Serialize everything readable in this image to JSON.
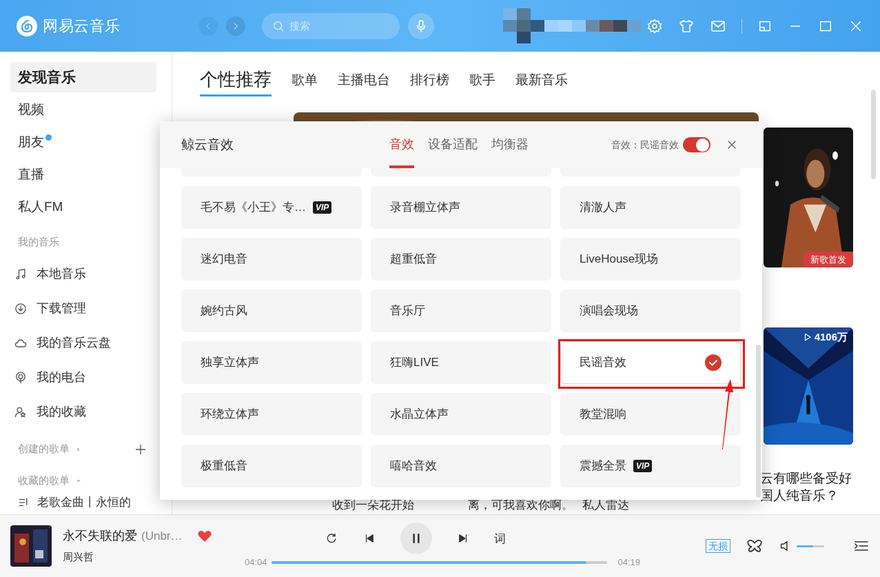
{
  "app": {
    "name": "网易云音乐",
    "search_placeholder": "搜索"
  },
  "sidebar": {
    "items": [
      {
        "label": "发现音乐",
        "selected": true,
        "dot": false
      },
      {
        "label": "视频",
        "selected": false,
        "dot": false
      },
      {
        "label": "朋友",
        "selected": false,
        "dot": true
      },
      {
        "label": "直播",
        "selected": false,
        "dot": false
      },
      {
        "label": "私人FM",
        "selected": false,
        "dot": false
      }
    ],
    "my_music_title": "我的音乐",
    "my_music": [
      {
        "label": "本地音乐"
      },
      {
        "label": "下载管理"
      },
      {
        "label": "我的音乐云盘"
      },
      {
        "label": "我的电台"
      },
      {
        "label": "我的收藏"
      }
    ],
    "created_title": "创建的歌单",
    "collected_title": "收藏的歌单",
    "playlists": [
      "老歌金曲丨永恒的"
    ]
  },
  "tabs": [
    {
      "label": "个性推荐",
      "selected": true
    },
    {
      "label": "歌单",
      "selected": false
    },
    {
      "label": "主播电台",
      "selected": false
    },
    {
      "label": "排行榜",
      "selected": false
    },
    {
      "label": "歌手",
      "selected": false
    },
    {
      "label": "最新音乐",
      "selected": false
    }
  ],
  "content": {
    "new_song_badge": "新歌首发",
    "play_count": "4106万",
    "captions": [
      "收到一朵花开始",
      "离，可我喜欢你啊。",
      "私人雷达"
    ],
    "right_caption": [
      "云有哪些备受好",
      "国人纯音乐？"
    ]
  },
  "dialog": {
    "title": "鲸云音效",
    "tabs": [
      {
        "label": "音效",
        "selected": true
      },
      {
        "label": "设备适配",
        "selected": false
      },
      {
        "label": "均衡器",
        "selected": false
      }
    ],
    "status_label": "音效：民谣音效",
    "toggle_on": true,
    "effects": [
      {
        "label": "毛不易《小王》专…",
        "selected": false,
        "badge": "VIP"
      },
      {
        "label": "录音棚立体声",
        "selected": false
      },
      {
        "label": "清澈人声",
        "selected": false
      },
      {
        "label": "迷幻电音",
        "selected": false
      },
      {
        "label": "超重低音",
        "selected": false
      },
      {
        "label": "LiveHouse现场",
        "selected": false
      },
      {
        "label": "婉约古风",
        "selected": false
      },
      {
        "label": "音乐厅",
        "selected": false
      },
      {
        "label": "演唱会现场",
        "selected": false
      },
      {
        "label": "独享立体声",
        "selected": false
      },
      {
        "label": "狂嗨LIVE",
        "selected": false
      },
      {
        "label": "民谣音效",
        "selected": true
      },
      {
        "label": "环绕立体声",
        "selected": false
      },
      {
        "label": "水晶立体声",
        "selected": false
      },
      {
        "label": "教堂混响",
        "selected": false
      },
      {
        "label": "极重低音",
        "selected": false
      },
      {
        "label": "嘻哈音效",
        "selected": false
      },
      {
        "label": "震撼全景",
        "selected": false,
        "badge": "VIP"
      }
    ]
  },
  "player": {
    "title": "永不失联的爱",
    "subtitle": "(Unbr…",
    "artist": "周兴哲",
    "liked": true,
    "playing": true,
    "elapsed": "04:04",
    "duration": "04:19",
    "level": 0.94,
    "lyrics_button": "词",
    "quality": "无损",
    "volume": {
      "level": 0.6
    }
  }
}
